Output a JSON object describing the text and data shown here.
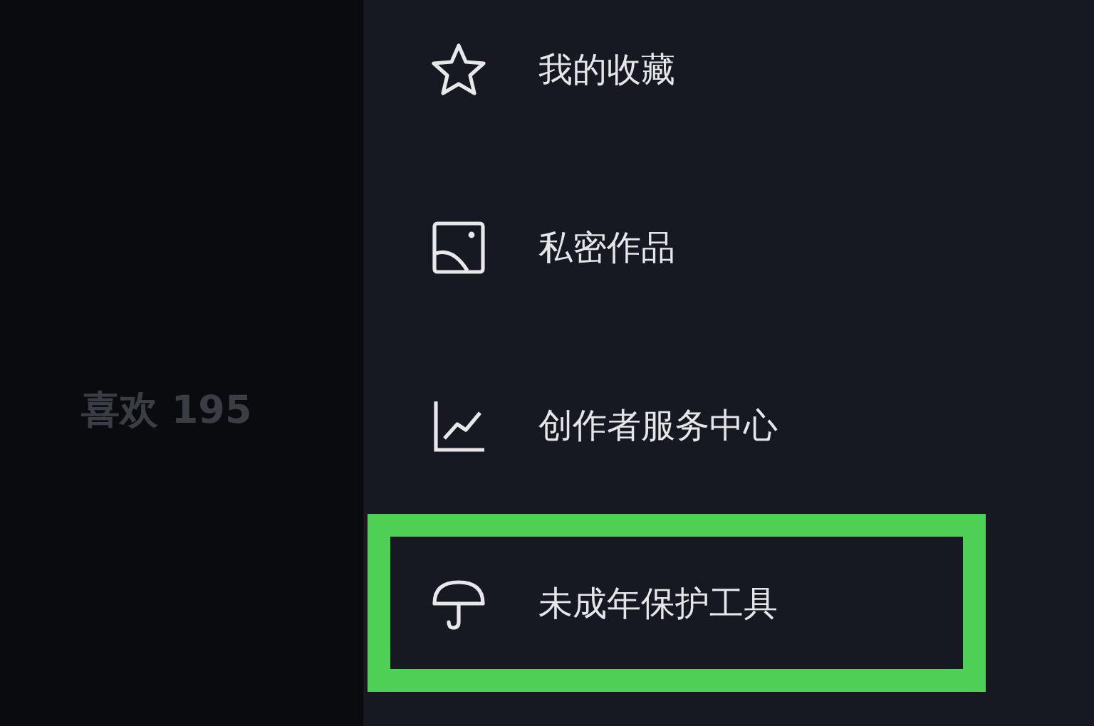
{
  "profile": {
    "likes": "喜欢 195"
  },
  "menu": [
    {
      "kind": "star",
      "label": "我的收藏",
      "highlighted": false
    },
    {
      "kind": "image",
      "label": "私密作品",
      "highlighted": false
    },
    {
      "kind": "chart",
      "label": "创作者服务中心",
      "highlighted": false
    },
    {
      "kind": "umbrella",
      "label": "未成年保护工具",
      "highlighted": true
    }
  ]
}
